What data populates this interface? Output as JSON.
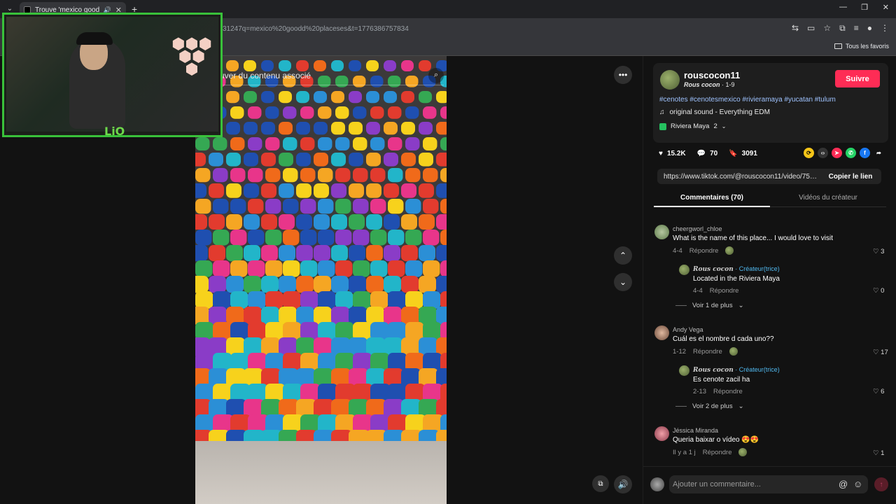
{
  "browser": {
    "tab_title": "Trouve 'mexico goodd plac",
    "url": "31247q=mexico%20goodd%20placeses&t=1776386757834",
    "bookmarks_all": "Tous les favoris"
  },
  "video": {
    "search_placeholder": "uver du contenu associé"
  },
  "webcam": {
    "tag": "LiO"
  },
  "post": {
    "author": "rouscocon11",
    "display_name": "Rous cocon",
    "date": "· 1-9",
    "follow_label": "Suivre",
    "hashtags": "#cenotes #cenotesmexico #rivieramaya #yucatan #tulum",
    "sound": "original sound - Everything EDM",
    "location": "Riviera Maya",
    "location_count": "2",
    "likes": "15.2K",
    "comments_count": "70",
    "saves": "3091",
    "link": "https://www.tiktok.com/@rouscocon11/video/7593...",
    "copy_label": "Copier le lien"
  },
  "tabs": {
    "comments": "Commentaires (70)",
    "creator_videos": "Vidéos du créateur"
  },
  "comments": [
    {
      "user": "cheergworl_chloe",
      "text": "What is the name of this place... I would love to visit",
      "date": "4-4",
      "reply": "Répondre",
      "likes": "3"
    },
    {
      "user": "Rous cocon",
      "badge": "· Créateur(trice)",
      "text": "Located in the Riviera Maya",
      "date": "4-4",
      "reply": "Répondre",
      "likes": "0"
    },
    {
      "more": "Voir 1 de plus"
    },
    {
      "user": "Andy Vega",
      "text": "Cuál es el nombre d cada uno??",
      "date": "1-12",
      "reply": "Répondre",
      "likes": "17"
    },
    {
      "user": "Rous cocon",
      "badge": "· Créateur(trice)",
      "text": "Es cenote zacil ha",
      "date": "2-13",
      "reply": "Répondre",
      "likes": "6"
    },
    {
      "more": "Voir 2 de plus"
    },
    {
      "user": "Jéssica Miranda",
      "text": "Queria baixar o vídeo 😍😍",
      "date": "Il y a 1 j",
      "reply": "Répondre",
      "likes": "1"
    }
  ],
  "compose": {
    "placeholder": "Ajouter un commentaire..."
  },
  "colors": {
    "accent": "#fe2c55",
    "hashtag": "#9fc3ff",
    "creator_badge": "#50b8ee",
    "webcam_border": "#39c13a"
  }
}
